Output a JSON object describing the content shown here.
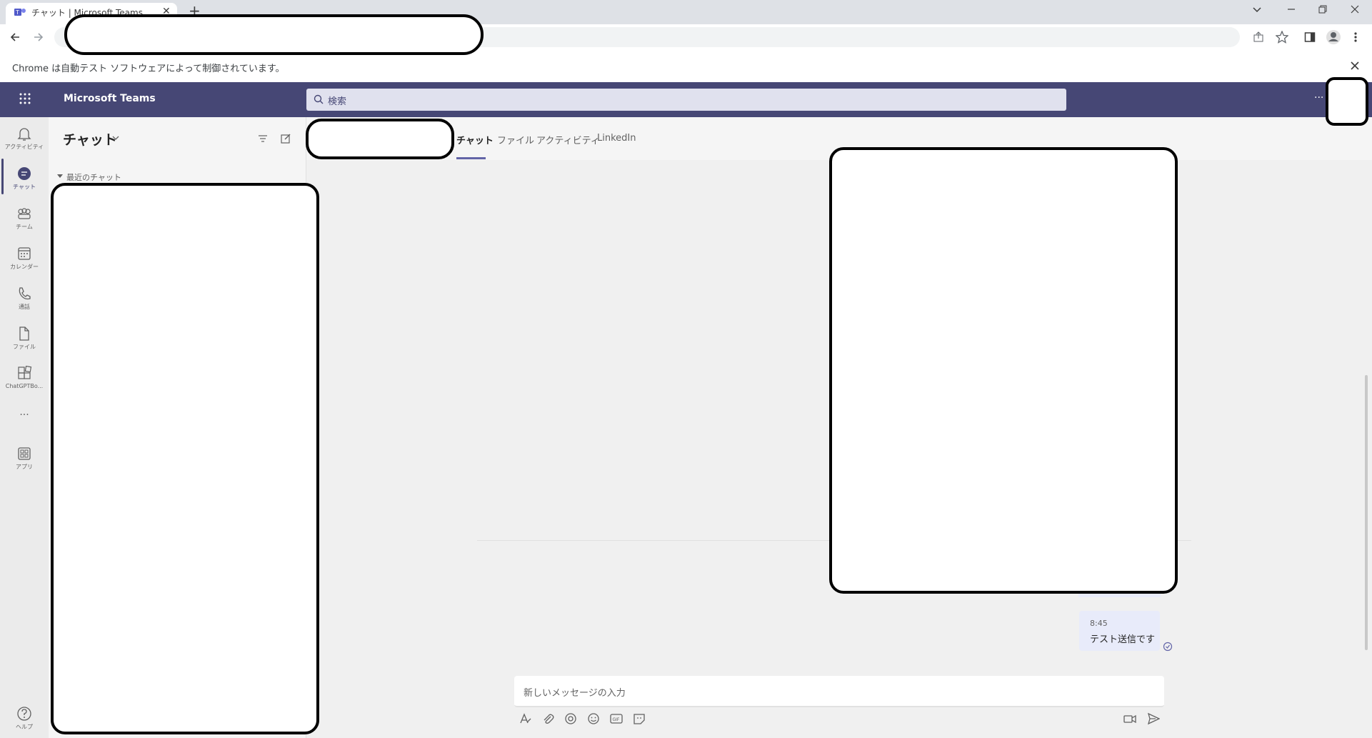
{
  "browser": {
    "tab_title": "チャット | Microsoft Teams",
    "new_tab_symbol": "+",
    "automation_infobar": "Chrome は自動テスト ソフトウェアによって制御されています。"
  },
  "header": {
    "app_title": "Microsoft Teams",
    "search_placeholder": "検索",
    "more_symbol": "···"
  },
  "rail": {
    "items": [
      {
        "label": "アクティビティ",
        "icon": "bell-icon"
      },
      {
        "label": "チャット",
        "icon": "chat-icon"
      },
      {
        "label": "チーム",
        "icon": "teams-icon"
      },
      {
        "label": "カレンダー",
        "icon": "calendar-icon"
      },
      {
        "label": "通話",
        "icon": "phone-icon"
      },
      {
        "label": "ファイル",
        "icon": "file-icon"
      },
      {
        "label": "ChatGPTBo...",
        "icon": "app-icon"
      },
      {
        "label": "アプリ",
        "icon": "apps-icon"
      },
      {
        "label": "ヘルプ",
        "icon": "help-icon"
      }
    ],
    "more_symbol": "···"
  },
  "chatlist": {
    "title": "チャット",
    "recent_section": "最近のチャット"
  },
  "conversation": {
    "tabs": [
      "チャット",
      "ファイル",
      "アクティビティ",
      "LinkedIn"
    ],
    "active_tab": "チャット"
  },
  "messages": [
    {
      "time": "8:45",
      "text": "テスト送信です",
      "status": "sent"
    }
  ],
  "compose": {
    "placeholder": "新しいメッセージの入力"
  },
  "colors": {
    "teams_purple": "#464775",
    "accent": "#6264a7",
    "bubble": "#e8ebfa"
  }
}
